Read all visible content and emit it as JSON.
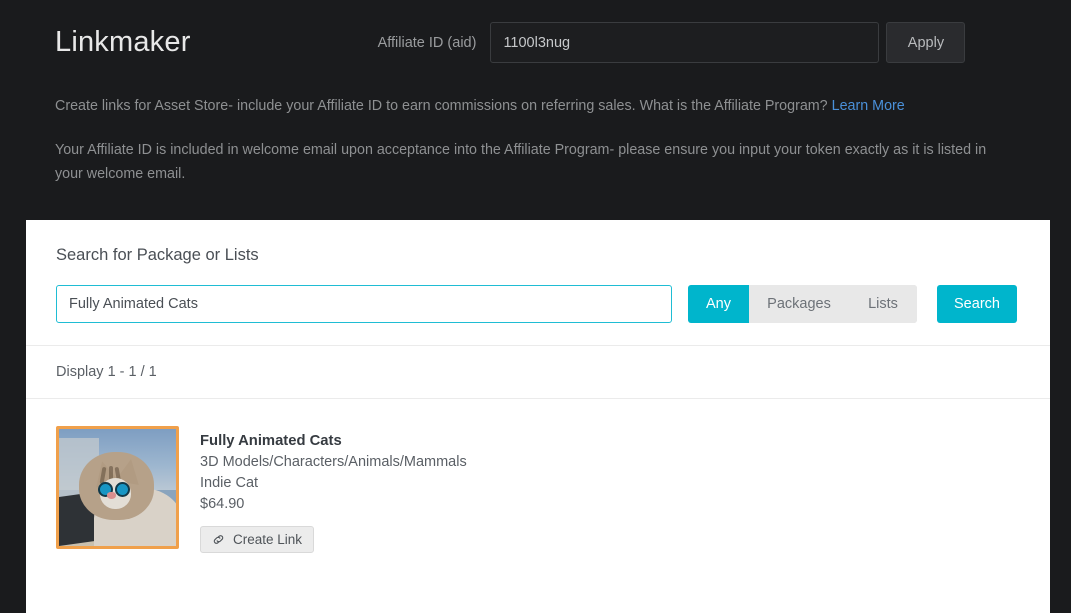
{
  "header": {
    "app_title": "Linkmaker",
    "affiliate_label": "Affiliate ID (aid)",
    "affiliate_value": "1100l3nug",
    "affiliate_placeholder": "",
    "apply_label": "Apply",
    "description_1_before": "Create links for Asset Store- include your Affiliate ID to earn commissions on referring sales. What is the Affiliate Program? ",
    "description_1_link": "Learn More",
    "description_2": "Your Affiliate ID is included in welcome email upon acceptance into the Affiliate Program- please ensure you input your token exactly as it is listed in your welcome email."
  },
  "search": {
    "heading": "Search for Package or Lists",
    "input_value": "Fully Animated Cats",
    "input_placeholder": "",
    "filters": [
      {
        "label": "Any",
        "active": true
      },
      {
        "label": "Packages",
        "active": false
      },
      {
        "label": "Lists",
        "active": false
      }
    ],
    "search_button": "Search"
  },
  "results": {
    "display_count": "Display 1 - 1 / 1",
    "items": [
      {
        "title": "Fully Animated Cats",
        "category": "3D Models/Characters/Animals/Mammals",
        "publisher": "Indie Cat",
        "price": "$64.90",
        "create_link_label": "Create Link",
        "thumbnail_alt": "cat-photo-thumbnail"
      }
    ]
  },
  "colors": {
    "background_dark": "#1a1b1d",
    "panel_white": "#ffffff",
    "accent_cyan": "#00b5cc",
    "focus_border": "#1fbdd4",
    "link_blue": "#4a90d9",
    "thumb_border_orange": "#f0a04b"
  }
}
